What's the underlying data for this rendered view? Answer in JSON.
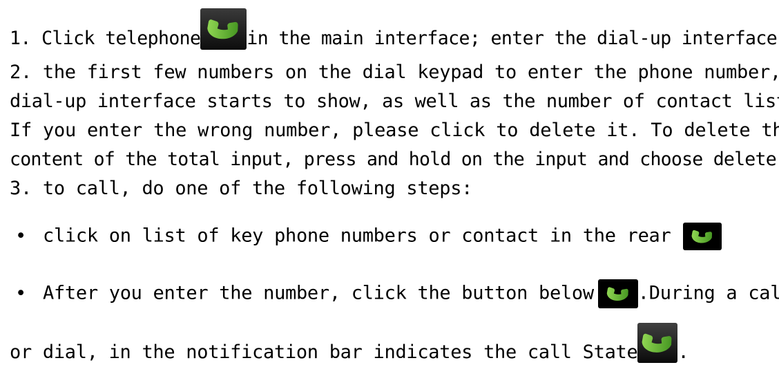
{
  "lines": {
    "l1_before": "1. Click telephone",
    "l1_after": "in the main interface; enter the dial-up interface.",
    "l2": "2. the first few numbers on the dial keypad to enter the phone number,",
    "l3": "dial-up interface starts to show, as well as the number of contact list.",
    "l4": "If you enter the wrong number, please click to delete it. To delete the",
    "l5": "content of the total input, press and hold on the input and choose delete.",
    "l6": "3. to call, do one of the following steps:",
    "l7_bullet": "•",
    "l7": "click on list of key phone numbers or contact in the rear",
    "l8_bullet": "•",
    "l8_before": "After you enter the number, click the button below",
    "l8_after": ".During a call",
    "l9_before": "or dial, in the notification bar indicates the call State",
    "l9_after": "."
  },
  "icons": {
    "phone": "phone-handset-icon",
    "handset_color": "#5fb32c"
  }
}
